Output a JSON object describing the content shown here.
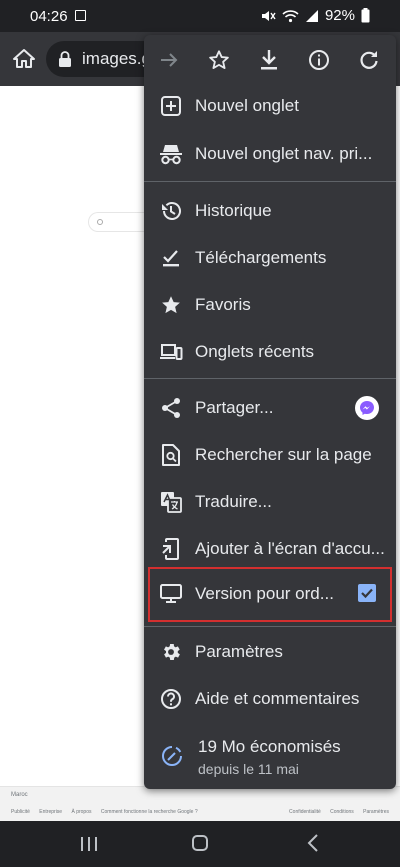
{
  "status_bar": {
    "time": "04:26",
    "battery": "92%",
    "icons": [
      "image-icon",
      "mute-icon",
      "wifi-icon",
      "signal-icon",
      "battery-icon"
    ]
  },
  "toolbar": {
    "url": "images.g",
    "home_icon": "home-icon",
    "lock_icon": "lock-icon"
  },
  "menu": {
    "top_actions": [
      "forward-icon",
      "bookmark-star-icon",
      "download-icon",
      "info-icon",
      "reload-icon"
    ],
    "items": [
      {
        "label": "Nouvel onglet",
        "icon": "plus-box-icon"
      },
      {
        "label": "Nouvel onglet nav. pri...",
        "icon": "incognito-icon"
      },
      {
        "label": "Historique",
        "icon": "history-icon"
      },
      {
        "label": "Téléchargements",
        "icon": "downloads-check-icon"
      },
      {
        "label": "Favoris",
        "icon": "star-icon"
      },
      {
        "label": "Onglets récents",
        "icon": "devices-icon"
      },
      {
        "label": "Partager...",
        "icon": "share-icon"
      },
      {
        "label": "Rechercher sur la page",
        "icon": "find-in-page-icon"
      },
      {
        "label": "Traduire...",
        "icon": "translate-icon"
      },
      {
        "label": "Ajouter à l'écran d'accu...",
        "icon": "add-to-home-icon"
      },
      {
        "label": "Version pour ord...",
        "icon": "desktop-icon",
        "checked": true
      },
      {
        "label": "Paramètres",
        "icon": "gear-icon"
      },
      {
        "label": "Aide et commentaires",
        "icon": "help-icon"
      }
    ],
    "savings": {
      "line1": "19 Mo économisés",
      "line2": "depuis le 11 mai"
    }
  },
  "page": {
    "footer_country": "Maroc",
    "footer_links": [
      "Publicité",
      "Entreprise",
      "À propos",
      "Comment fonctionne la recherche Google ?"
    ],
    "footer_right": [
      "Confidentialité",
      "Conditions",
      "Paramètres"
    ]
  },
  "colors": {
    "menu_bg": "#35363a",
    "toolbar_bg": "#35363a",
    "status_bg": "#202124",
    "text": "#e8eaed",
    "accent": "#8ab4f8",
    "highlight": "#d32f2f"
  }
}
